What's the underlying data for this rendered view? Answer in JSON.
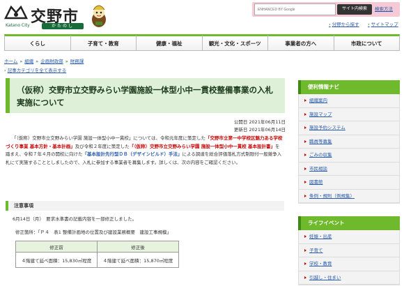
{
  "header": {
    "logo_text": "交野市",
    "logo_sub": "Katano City",
    "logo_kana": "かたのし",
    "search": {
      "placeholder": "ENHANCED BY Google",
      "button": "サイト内検索",
      "help": "検索方法"
    },
    "top_links": [
      "分野から探す",
      "サイトマップ"
    ]
  },
  "gnav": [
    "くらし",
    "子育て・教育",
    "健康・福祉",
    "観光・文化・スポーツ",
    "事業者の方へ",
    "市政について"
  ],
  "breadcrumb": [
    "ホーム",
    "組織",
    "企画財政部",
    "財務課"
  ],
  "all_category": "記事カテゴリを全て表示する",
  "article": {
    "title": "（仮称）交野市立交野みらい学園施設一体型小中一貫校整備事業の入札実施について",
    "published": "公開日 2021年06月11日",
    "updated": "更新日 2021年06月14日",
    "body_1": "「（仮称）交野市立交野みらい学園 施設一体型小中一貫校」については、令和元年度に策定した",
    "body_red_1": "「交野市立第一中学校区魅力ある学校づくり事業 基本方針・基本計画」",
    "body_2": "及び令和２年度に策定した",
    "body_red_2": "「（仮称）交野市立交野みらい学園 施設一体型小中一貫校 基本設計書」",
    "body_3": "を踏まえ、令和７年４月の開校に向けた",
    "body_blue": "「基本設計先行型ＤＢ（デザインビルド）手法」",
    "body_4": "による調達を総合評価落札方式制限付一般競争入札にて実施することとしましたので、入札に参加する事業者を募集します。詳しくは、次の内容をご確認ください。",
    "notice_head": "注意事項",
    "notice_1": "6月14日（月）　要求水準書の記載内容を一部修正しました。",
    "notice_2": "修正箇所：「Ｐ４　表1 整備計画地の位置及び建設業務概要　建設工事規模」",
    "table_headers": [
      "修正前",
      "修正後"
    ],
    "table_row": [
      "４階建て延べ面積：15,830㎡程度",
      "４階建て延べ面積：15,870㎡程度"
    ]
  },
  "sidebar": {
    "nav_title": "便利情報ナビ",
    "nav_items": [
      "組織案内",
      "施設マップ",
      "施設予約システム",
      "職員等募集",
      "ごみの収集",
      "市民相談",
      "図書館",
      "条例・規則（例規集）"
    ],
    "event_title": "ライフイベント",
    "event_items": [
      "妊娠・出産",
      "子育て",
      "学校・教育",
      "引越し・住まい"
    ]
  },
  "colors": {
    "accent_green": "#6fba2c",
    "link_blue": "#2a5caa",
    "highlight_red": "#cc0000",
    "title_bg": "#dff0d8"
  }
}
